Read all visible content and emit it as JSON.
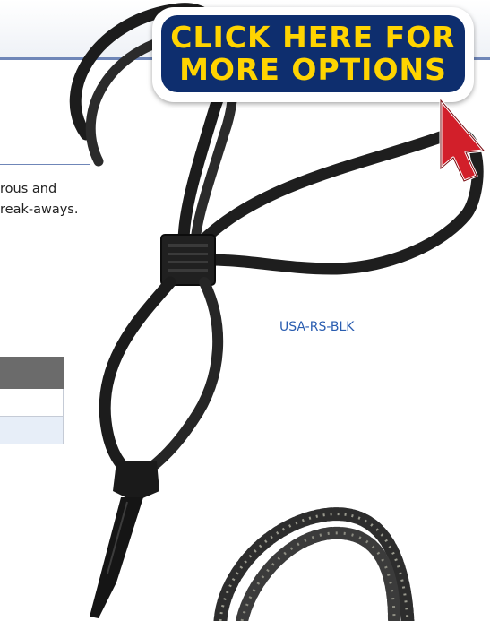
{
  "description": {
    "line1": "rous and",
    "line2": "reak-aways."
  },
  "cta": {
    "line1": "CLICK HERE FOR",
    "line2": "MORE OPTIONS"
  },
  "product": {
    "sku": "USA-RS-BLK"
  },
  "icons": [
    "pointer-arrow-icon"
  ],
  "colors": {
    "cta_background": "#0e2e6e",
    "cta_text": "#ffd400",
    "arrow": "#d21f2a",
    "link": "#2a5db0",
    "rule": "#6f86b8"
  }
}
